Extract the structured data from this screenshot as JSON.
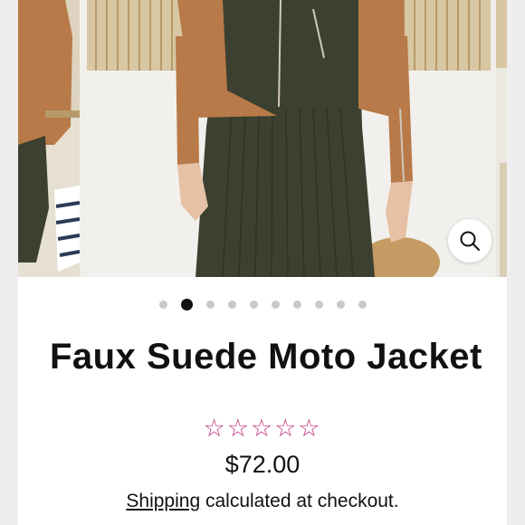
{
  "product": {
    "title": "Faux Suede Moto Jacket",
    "rating": {
      "stars": 5,
      "filled": 0,
      "glyph": "☆☆☆☆☆"
    },
    "price": "$72.00",
    "shipping": {
      "link_text": "Shipping",
      "rest_text": "calculated at checkout."
    }
  },
  "gallery": {
    "total_images": 10,
    "active_index": 1,
    "zoom_icon": "magnifier-icon"
  },
  "colors": {
    "star": "#c2337a",
    "active_dot": "#111111",
    "inactive_dot": "#c9c9c9",
    "jacket": "#b87a48",
    "dress": "#3c4030"
  }
}
